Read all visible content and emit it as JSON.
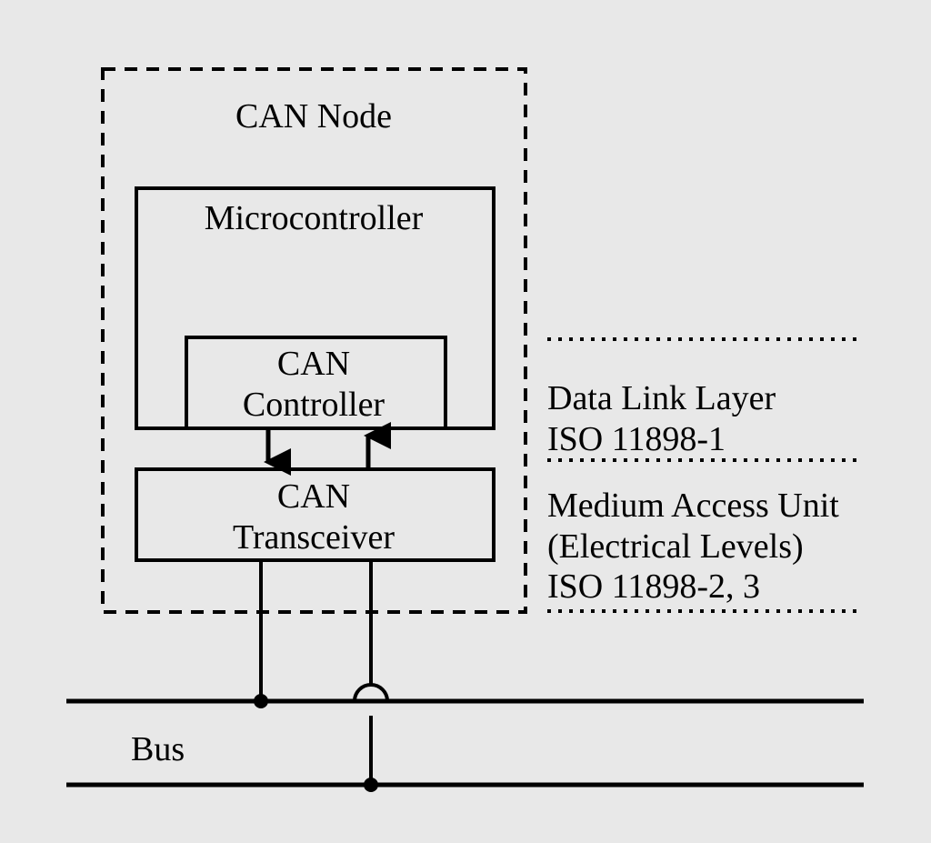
{
  "node_title": "CAN Node",
  "microcontroller_label": "Microcontroller",
  "can_controller_label_line1": "CAN",
  "can_controller_label_line2": "Controller",
  "can_transceiver_label_line1": "CAN",
  "can_transceiver_label_line2": "Transceiver",
  "bus_label": "Bus",
  "data_link_label_line1": "Data Link Layer",
  "data_link_label_line2": "ISO 11898-1",
  "medium_access_label_line1": "Medium Access Unit",
  "medium_access_label_line2": "(Electrical Levels)",
  "medium_access_label_line3": "ISO 11898-2, 3"
}
